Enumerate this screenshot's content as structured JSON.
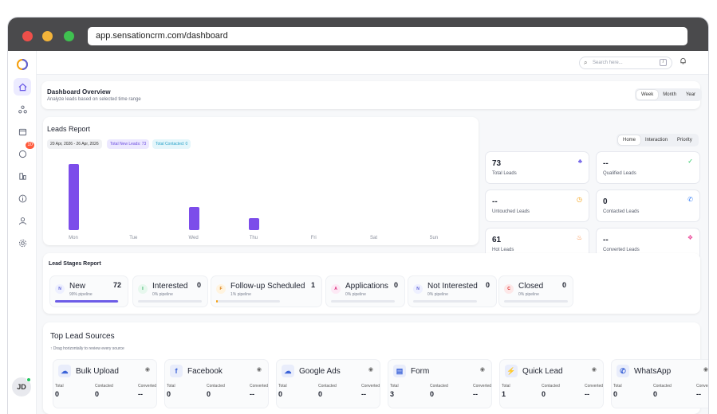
{
  "browser": {
    "url": "app.sensationcrm.com/dashboard"
  },
  "topbar": {
    "search_placeholder": "Search here...",
    "search_shortcut": "/"
  },
  "sidebar": {
    "notification_count": "10",
    "avatar_initials": "JD"
  },
  "overview": {
    "title": "Dashboard Overview",
    "subtitle": "Analyze leads based on selected time range",
    "ranges": [
      "Week",
      "Month",
      "Year"
    ],
    "selected_range": "Week"
  },
  "leads_report": {
    "title": "Leads Report",
    "date_range": "20 Apr, 2026 - 26 Apr, 2026",
    "total_new": "Total New Leads: 73",
    "total_contacted": "Total Contacted: 0"
  },
  "chart_data": {
    "type": "bar",
    "categories": [
      "Mon",
      "Tue",
      "Wed",
      "Thu",
      "Fri",
      "Sat",
      "Sun"
    ],
    "values": [
      43,
      0,
      15,
      8,
      0,
      0,
      0
    ],
    "title": "Leads Report",
    "xlabel": "",
    "ylabel": "",
    "ylim": [
      0,
      45
    ],
    "grid": false,
    "color": "#7c4dea"
  },
  "view_tabs": [
    "Home",
    "Interaction",
    "Priority"
  ],
  "selected_view": "Home",
  "stats": [
    {
      "value": "73",
      "label": "Total Leads",
      "icon": "users-icon",
      "color": "#6c5ce7"
    },
    {
      "value": "--",
      "label": "Qualified Leads",
      "icon": "check-circle-icon",
      "color": "#22c55e"
    },
    {
      "value": "--",
      "label": "Untouched Leads",
      "icon": "clock-icon",
      "color": "#f59e0b"
    },
    {
      "value": "0",
      "label": "Contacted Leads",
      "icon": "phone-icon",
      "color": "#3b82f6"
    },
    {
      "value": "61",
      "label": "Hot Leads",
      "icon": "flame-icon",
      "color": "#f97316"
    },
    {
      "value": "--",
      "label": "Converted Leads",
      "icon": "layers-icon",
      "color": "#ec4899"
    }
  ],
  "stages": {
    "title": "Lead Stages Report",
    "items": [
      {
        "initial": "N",
        "name": "New",
        "count": "72",
        "pipeline": "99% pipeline",
        "pct": 99,
        "bg": "#eef0ff",
        "fg": "#5b5fd6"
      },
      {
        "initial": "I",
        "name": "Interested",
        "count": "0",
        "pipeline": "0% pipeline",
        "pct": 0,
        "bg": "#e7f8ee",
        "fg": "#16a34a"
      },
      {
        "initial": "F",
        "name": "Follow-up Scheduled",
        "count": "1",
        "pipeline": "1% pipeline",
        "pct": 1,
        "bg": "#fff4e0",
        "fg": "#d97706"
      },
      {
        "initial": "A",
        "name": "Applications",
        "count": "0",
        "pipeline": "0% pipeline",
        "pct": 0,
        "bg": "#fde9f5",
        "fg": "#db2777"
      },
      {
        "initial": "N",
        "name": "Not Interested",
        "count": "0",
        "pipeline": "0% pipeline",
        "pct": 0,
        "bg": "#eef0ff",
        "fg": "#5b5fd6"
      },
      {
        "initial": "C",
        "name": "Closed",
        "count": "0",
        "pipeline": "0% pipeline",
        "pct": 0,
        "bg": "#fde8e8",
        "fg": "#dc2626"
      }
    ]
  },
  "sources": {
    "title": "Top Lead Sources",
    "hint": "Drag horizontally to review every source",
    "col_labels": [
      "Total",
      "Contacted",
      "Converted"
    ],
    "items": [
      {
        "name": "Bulk Upload",
        "icon": "cloud-upload-icon",
        "glyph": "☁",
        "total": "0",
        "contacted": "0",
        "converted": "--"
      },
      {
        "name": "Facebook",
        "icon": "facebook-icon",
        "glyph": "f",
        "total": "0",
        "contacted": "0",
        "converted": "--"
      },
      {
        "name": "Google Ads",
        "icon": "cloud-upload-icon",
        "glyph": "☁",
        "total": "0",
        "contacted": "0",
        "converted": "--"
      },
      {
        "name": "Form",
        "icon": "form-icon",
        "glyph": "▤",
        "total": "3",
        "contacted": "0",
        "converted": "--"
      },
      {
        "name": "Quick Lead",
        "icon": "lightning-icon",
        "glyph": "⚡",
        "total": "1",
        "contacted": "0",
        "converted": "--"
      },
      {
        "name": "WhatsApp",
        "icon": "whatsapp-icon",
        "glyph": "✆",
        "total": "0",
        "contacted": "0",
        "converted": "--"
      }
    ]
  }
}
